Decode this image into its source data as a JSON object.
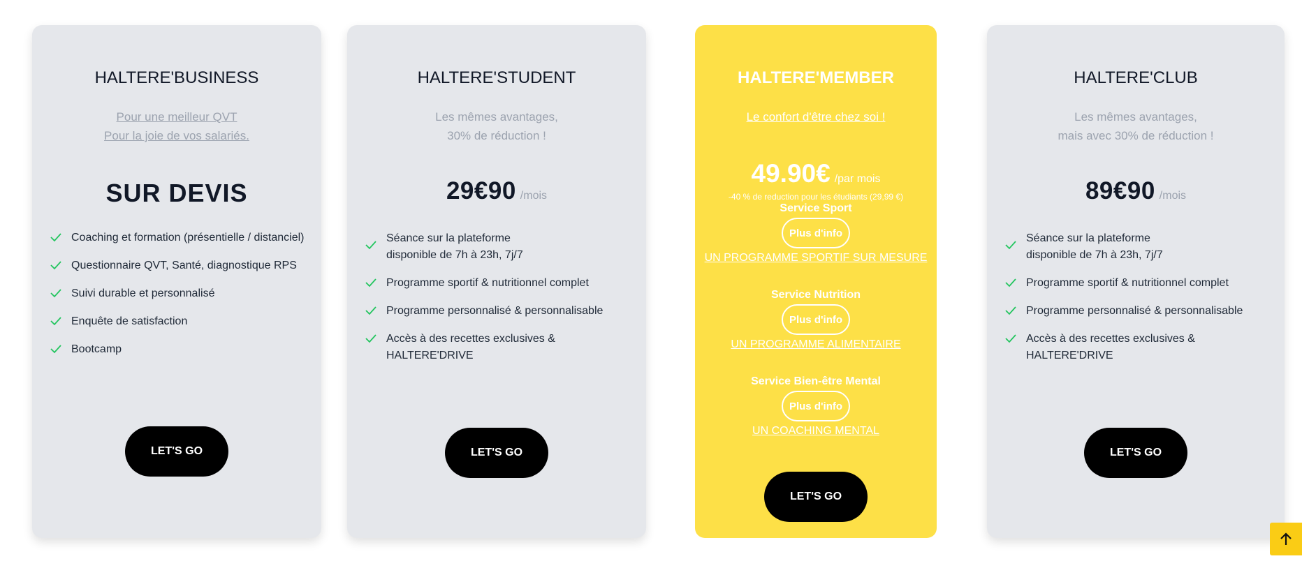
{
  "plans": {
    "business": {
      "title": "HALTERE'BUSINESS",
      "subtitle": [
        "Pour une meilleur QVT",
        "Pour la joie de vos salariés."
      ],
      "price": "SUR DEVIS",
      "features": [
        "Coaching et formation (présentielle / distanciel)",
        "Questionnaire QVT, Santé, diagnostique RPS",
        "Suivi durable et personnalisé",
        "Enquête de satisfaction",
        "Bootcamp"
      ],
      "cta": "LET'S GO"
    },
    "student": {
      "title": "HALTERE'STUDENT",
      "subtitle": [
        "Les mêmes avantages,",
        "30% de réduction !"
      ],
      "price": "29€90",
      "period": "/mois",
      "features": [
        [
          "Séance sur la plateforme",
          "disponible de 7h à 23h, 7j/7"
        ],
        "Programme sportif & nutritionnel complet",
        "Programme personnalisé & personnalisable",
        "Accès à des recettes exclusives & HALTERE'DRIVE"
      ],
      "cta": "LET'S GO"
    },
    "member": {
      "title": "HALTERE'MEMBER",
      "subtitle": "Le confort d'être chez soi !",
      "price": "49.90€",
      "period": "/par mois",
      "note": "-40 % de reduction pour les étudiants (29,99 €)",
      "services": [
        {
          "name": "Service Sport",
          "button": "Plus d'info",
          "link": "UN PROGRAMME SPORTIF SUR MESURE"
        },
        {
          "name": "Service Nutrition",
          "button": "Plus d'info",
          "link": "UN PROGRAMME ALIMENTAIRE"
        },
        {
          "name": "Service Bien-être Mental",
          "button": "Plus d'info",
          "link": "UN COACHING MENTAL"
        }
      ],
      "cta": "LET'S GO"
    },
    "club": {
      "title": "HALTERE'CLUB",
      "subtitle": [
        "Les mêmes avantages,",
        "mais avec 30% de réduction !"
      ],
      "price": "89€90",
      "period": "/mois",
      "features": [
        [
          "Séance sur la plateforme",
          "disponible de 7h à 23h, 7j/7"
        ],
        "Programme sportif & nutritionnel complet",
        "Programme personnalisé & personnalisable",
        "Accès à des recettes exclusives & HALTERE'DRIVE"
      ],
      "cta": "LET'S GO"
    }
  },
  "icons": {
    "check": "check-icon",
    "back_to_top": "arrow-up-icon"
  },
  "colors": {
    "card_bg": "#e5e7eb",
    "featured_bg": "#fde047",
    "check": "#22c55e",
    "cta_bg": "#000000",
    "back_to_top_bg": "#facc15"
  }
}
